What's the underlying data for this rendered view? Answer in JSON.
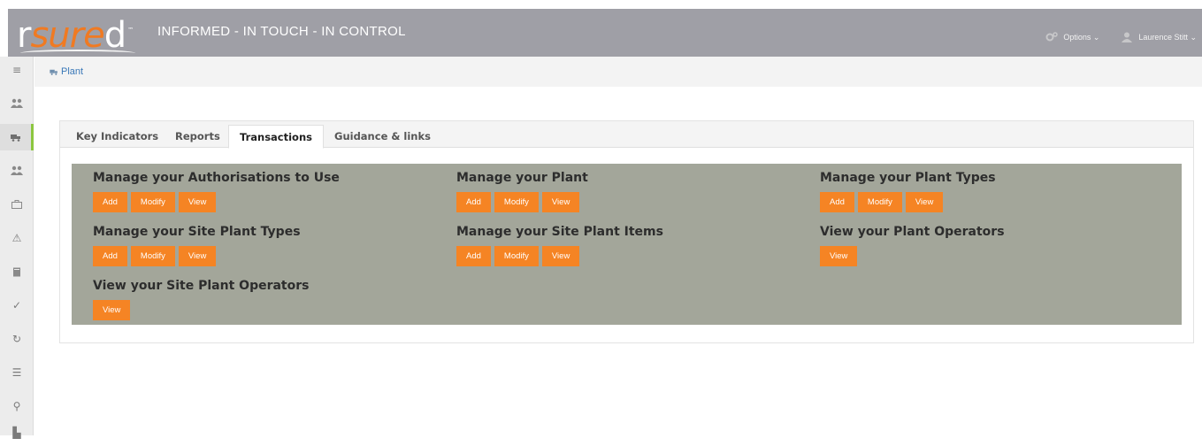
{
  "header": {
    "logo_prefix": "r",
    "logo_mid": "sure",
    "logo_suffix": "d",
    "logo_tm": "™",
    "tagline": "INFORMED - IN TOUCH - IN CONTROL",
    "options_label": "Options ⌄",
    "user_label": "Laurence Stitt ⌄"
  },
  "sidebar": {
    "items": [
      {
        "icon": "menu-icon",
        "glyph": "≡"
      },
      {
        "icon": "users-icon",
        "glyph": "👥"
      },
      {
        "icon": "truck-icon",
        "glyph": "🚚"
      },
      {
        "icon": "group-icon",
        "glyph": "👥"
      },
      {
        "icon": "briefcase-icon",
        "glyph": "💼"
      },
      {
        "icon": "warning-icon",
        "glyph": "⚠"
      },
      {
        "icon": "book-icon",
        "glyph": "📘"
      },
      {
        "icon": "check-icon",
        "glyph": "✓"
      },
      {
        "icon": "refresh-icon",
        "glyph": "↻"
      },
      {
        "icon": "list-icon",
        "glyph": "☰"
      },
      {
        "icon": "map-marker-icon",
        "glyph": "⚲"
      },
      {
        "icon": "chart-icon",
        "glyph": "▙"
      }
    ]
  },
  "breadcrumb": {
    "label": "Plant"
  },
  "tabs": [
    {
      "label": "Key Indicators"
    },
    {
      "label": "Reports"
    },
    {
      "label": "Transactions"
    },
    {
      "label": "Guidance & links"
    }
  ],
  "groups": [
    {
      "title": "Manage your Authorisations to Use",
      "buttons": [
        "Add",
        "Modify",
        "View"
      ]
    },
    {
      "title": "Manage your Plant",
      "buttons": [
        "Add",
        "Modify",
        "View"
      ]
    },
    {
      "title": "Manage your Plant Types",
      "buttons": [
        "Add",
        "Modify",
        "View"
      ]
    },
    {
      "title": "Manage your Site Plant Types",
      "buttons": [
        "Add",
        "Modify",
        "View"
      ]
    },
    {
      "title": "Manage your Site Plant Items",
      "buttons": [
        "Add",
        "Modify",
        "View"
      ]
    },
    {
      "title": "View your Plant Operators",
      "buttons": [
        "View"
      ]
    },
    {
      "title": "View your Site Plant Operators",
      "buttons": [
        "View"
      ]
    }
  ],
  "colors": {
    "header_bg": "#9f9fa6",
    "accent": "#f58424",
    "panel_box": "#a3a69a",
    "active_nav": "#8cc63f",
    "link": "#3a78b8"
  }
}
